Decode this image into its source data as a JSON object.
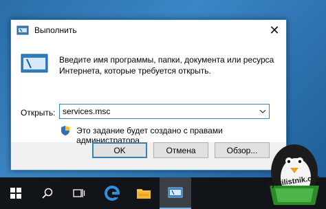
{
  "dialog": {
    "title": "Выполнить",
    "description": "Введите имя программы, папки, документа или ресурса Интернета, которые требуется открыть.",
    "open_label": "Открыть:",
    "open_value": "services.msc",
    "admin_note": "Это задание будет создано с правами администратора",
    "ok_label": "OK",
    "cancel_label": "Отмена",
    "browse_label": "Обзор..."
  },
  "taskbar": {
    "items": [
      "start-icon",
      "search-icon",
      "task-view-icon",
      "edge-browser-icon",
      "file-explorer-icon",
      "run-app-icon"
    ]
  },
  "watermark": {
    "text": "pyatilistnik.org"
  },
  "colors": {
    "accent": "#3c7fb1",
    "taskbar": "#111418",
    "dialog_bg": "#f0f0f0"
  }
}
